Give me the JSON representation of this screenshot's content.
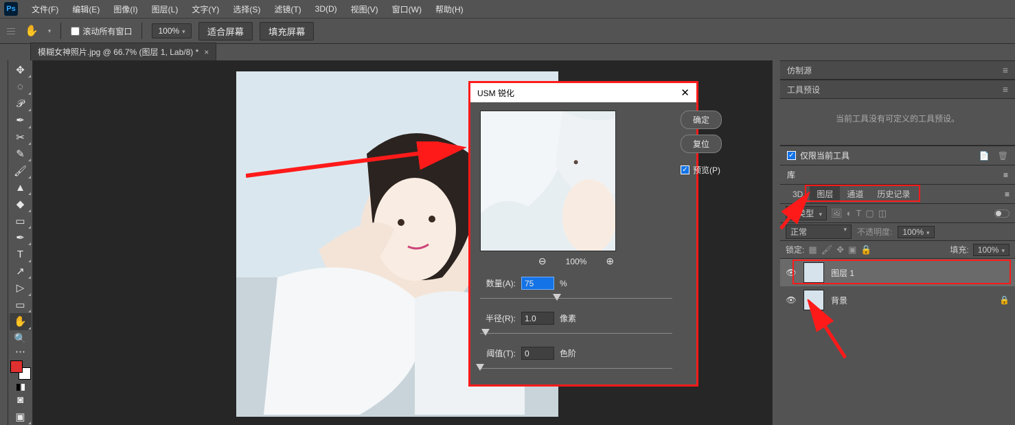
{
  "menu": [
    "文件(F)",
    "编辑(E)",
    "图像(I)",
    "图层(L)",
    "文字(Y)",
    "选择(S)",
    "滤镜(T)",
    "3D(D)",
    "视图(V)",
    "窗口(W)",
    "帮助(H)"
  ],
  "options": {
    "scroll_all": "滚动所有窗口",
    "zoom": "100%",
    "fit": "适合屏幕",
    "fill": "填充屏幕"
  },
  "doc_tab": {
    "title": "模糊女神照片.jpg @ 66.7% (图层 1, Lab/8) *"
  },
  "dialog": {
    "title": "USM 锐化",
    "ok": "确定",
    "reset": "复位",
    "preview_chk": "预览(P)",
    "zoom_pct": "100%",
    "amount_label": "数量(A):",
    "amount_val": "75",
    "amount_unit": "%",
    "radius_label": "半径(R):",
    "radius_val": "1.0",
    "radius_unit": "像素",
    "threshold_label": "阈值(T):",
    "threshold_val": "0",
    "threshold_unit": "色阶"
  },
  "right": {
    "clone_src": "仿制源",
    "tool_presets": "工具预设",
    "tool_presets_empty": "当前工具没有可定义的工具预设。",
    "only_current": "仅限当前工具",
    "library": "库",
    "tabs": {
      "d3": "3D",
      "layers": "图层",
      "channels": "通道",
      "history": "历史记录"
    },
    "filter_kind": "类型",
    "blend_mode": "正常",
    "opacity_label": "不透明度:",
    "opacity_val": "100%",
    "lock_label": "锁定:",
    "fill_label": "填充:",
    "fill_val": "100%",
    "layer1": "图层 1",
    "bg": "背景"
  }
}
